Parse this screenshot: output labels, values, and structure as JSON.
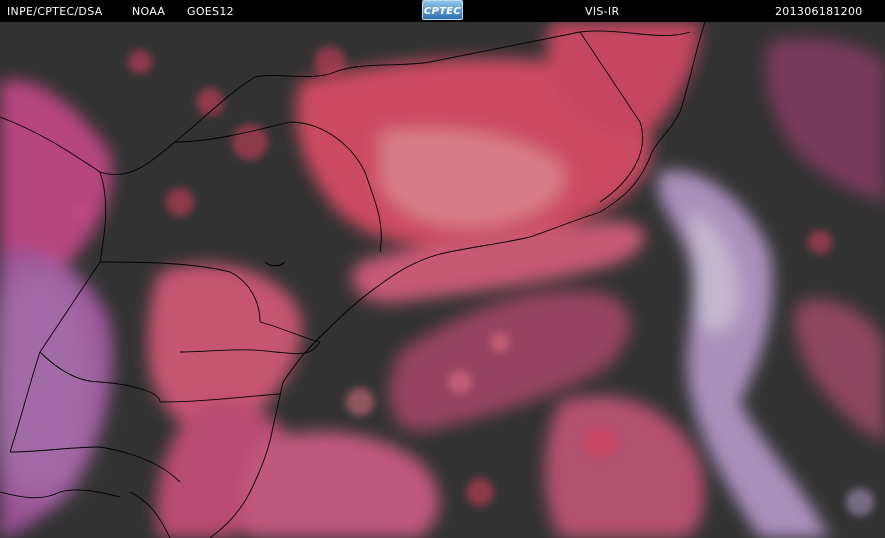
{
  "header": {
    "agency": "INPE/CPTEC/DSA",
    "org": "NOAA",
    "satellite": "GOES12",
    "logo_text": "CPTEC",
    "channel": "VIS-IR",
    "timestamp": "201306181200"
  },
  "colors": {
    "background": "#000000",
    "land_dark": "#333333",
    "cloud_red": "#d9415f",
    "cloud_pink": "#e27385",
    "cloud_violet": "#a95aa6",
    "cloud_lavender": "#b59ac8",
    "borders": "#000000"
  }
}
